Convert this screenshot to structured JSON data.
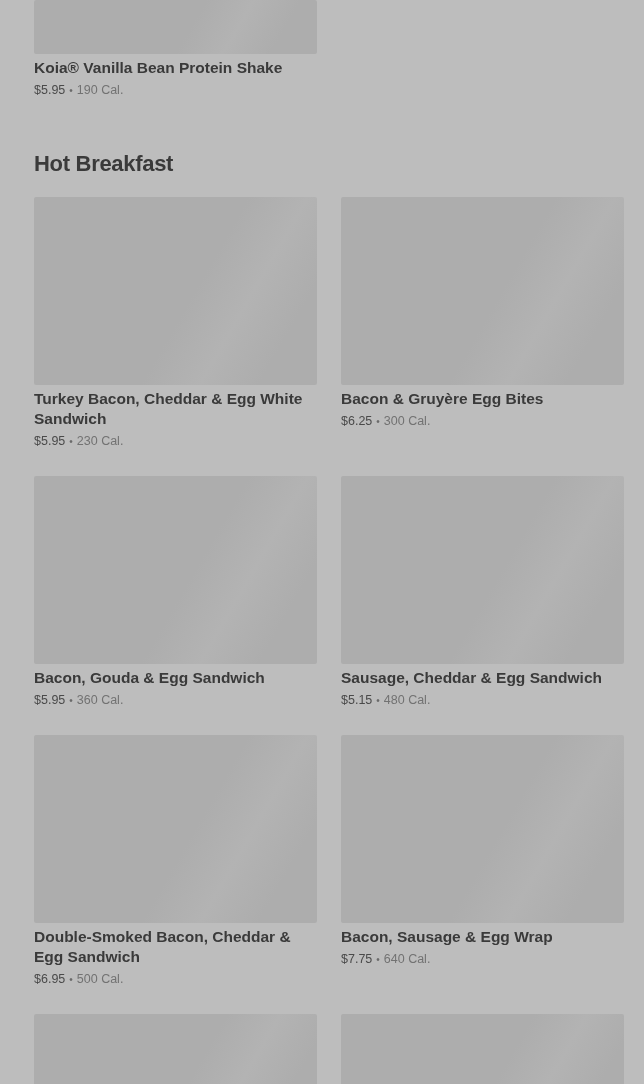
{
  "previous_item": {
    "name": "Koia® Vanilla Bean Protein Shake",
    "price": "$5.95",
    "separator": "•",
    "calories": "190 Cal."
  },
  "section": {
    "title": "Hot Breakfast",
    "items": [
      {
        "kind": "product",
        "name": "Turkey Bacon, Cheddar & Egg White Sandwich",
        "price": "$5.95",
        "separator": "•",
        "calories": "230 Cal."
      },
      {
        "kind": "product",
        "name": "Bacon & Gruyère Egg Bites",
        "price": "$6.25",
        "separator": "•",
        "calories": "300 Cal."
      },
      {
        "kind": "product",
        "name": "Bacon, Gouda & Egg Sandwich",
        "price": "$5.95",
        "separator": "•",
        "calories": "360 Cal."
      },
      {
        "kind": "product",
        "name": "Sausage, Cheddar & Egg Sandwich",
        "price": "$5.15",
        "separator": "•",
        "calories": "480 Cal."
      },
      {
        "kind": "product",
        "name": "Double-Smoked Bacon, Cheddar & Egg Sandwich",
        "price": "$6.95",
        "separator": "•",
        "calories": "500 Cal."
      },
      {
        "kind": "product",
        "name": "Bacon, Sausage & Egg Wrap",
        "price": "$7.75",
        "separator": "•",
        "calories": "640 Cal."
      },
      {
        "kind": "placeholder"
      },
      {
        "kind": "placeholder"
      }
    ]
  }
}
